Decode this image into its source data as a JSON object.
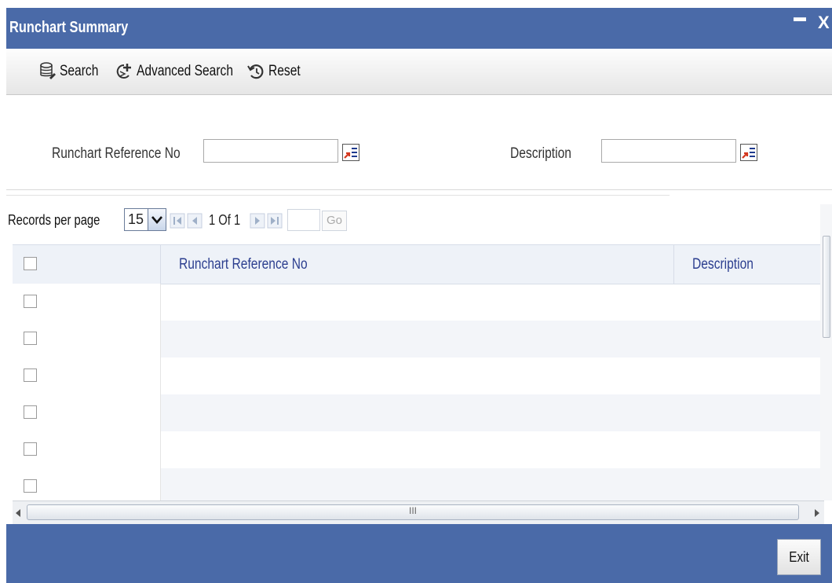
{
  "window": {
    "title": "Runchart Summary",
    "minimize_glyph": "▬",
    "close_glyph": "X"
  },
  "toolbar": {
    "search_label": "Search",
    "advanced_search_label": "Advanced Search",
    "reset_label": "Reset"
  },
  "filters": {
    "ref_label": "Runchart Reference No",
    "ref_value": "",
    "desc_label": "Description",
    "desc_value": ""
  },
  "pager": {
    "records_label": "Records per page",
    "records_value": "15",
    "page_info": "1 Of 1",
    "go_label": "Go",
    "go_value": ""
  },
  "grid": {
    "col_ref": "Runchart Reference No",
    "col_desc": "Description",
    "scroll_marker": "III"
  },
  "footer": {
    "exit_label": "Exit"
  },
  "colors": {
    "brand": "#4a6aa8",
    "header_text": "#2b3e8f",
    "row_alt": "#f3f5f9"
  },
  "icons": [
    "search-icon",
    "advanced-search-icon",
    "reset-icon",
    "lov-icon",
    "first-page-icon",
    "prev-page-icon",
    "next-page-icon",
    "last-page-icon",
    "chevron-down-icon"
  ]
}
